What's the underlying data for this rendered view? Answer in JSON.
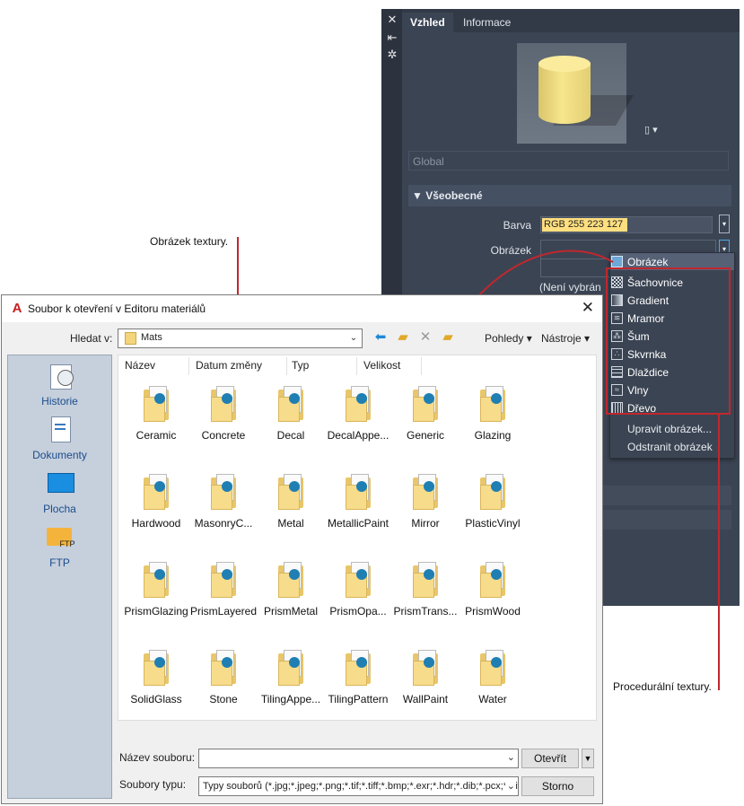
{
  "palette": {
    "tabs": [
      "Vzhled",
      "Informace"
    ],
    "strip_icons": [
      "close-icon",
      "collapse-icon",
      "settings-icon"
    ],
    "preview_shape_menu": "▾",
    "global_placeholder": "Global",
    "section_title": "Všeobecné",
    "color_label": "Barva",
    "color_value": "RGB 255 223 127",
    "color_swatch": "#ffdf7f",
    "image_label": "Obrázek",
    "image_none": "(Není vybrán"
  },
  "menu": {
    "header": "Obrázek",
    "procedural": [
      {
        "label": "Šachovnice",
        "icon": "checker-icon"
      },
      {
        "label": "Gradient",
        "icon": "gradient-icon"
      },
      {
        "label": "Mramor",
        "icon": "marble-icon"
      },
      {
        "label": "Šum",
        "icon": "noise-icon"
      },
      {
        "label": "Skvrnka",
        "icon": "speckle-icon"
      },
      {
        "label": "Dlaždice",
        "icon": "tiles-icon"
      },
      {
        "label": "Vlny",
        "icon": "waves-icon"
      },
      {
        "label": "Dřevo",
        "icon": "wood-icon"
      }
    ],
    "actions": [
      "Upravit obrázek...",
      "Odstranit obrázek"
    ]
  },
  "callouts": {
    "texture_image": "Obrázek textury.",
    "procedural_textures": "Procedurální textury."
  },
  "dialog": {
    "title": "Soubor k otevření v Editoru materiálů",
    "look_in_label": "Hledat v:",
    "look_in_value": "Mats",
    "views_label": "Pohledy",
    "tools_label": "Nástroje",
    "places": [
      {
        "label": "Historie",
        "icon": "history-icon"
      },
      {
        "label": "Dokumenty",
        "icon": "documents-icon"
      },
      {
        "label": "Plocha",
        "icon": "desktop-icon"
      },
      {
        "label": "FTP",
        "icon": "ftp-folder-icon"
      }
    ],
    "columns": [
      "Název",
      "Datum změny",
      "Typ",
      "Velikost"
    ],
    "files": [
      "Ceramic",
      "Concrete",
      "Decal",
      "DecalAppe...",
      "Generic",
      "Glazing",
      "Hardwood",
      "MasonryC...",
      "Metal",
      "MetallicPaint",
      "Mirror",
      "PlasticVinyl",
      "PrismGlazing",
      "PrismLayered",
      "PrismMetal",
      "PrismOpa...",
      "PrismTrans...",
      "PrismWood",
      "SolidGlass",
      "Stone",
      "TilingAppe...",
      "TilingPattern",
      "WallPaint",
      "Water"
    ],
    "file_name_label": "Název souboru:",
    "file_name_value": "",
    "file_type_label": "Soubory typu:",
    "file_type_value": "Typy souborů  (*.jpg;*.jpeg;*.png;*.tif;*.tiff;*.bmp;*.exr;*.hdr;*.dib;*.pcx;*.gif",
    "open_button": "Otevřít",
    "cancel_button": "Storno"
  }
}
